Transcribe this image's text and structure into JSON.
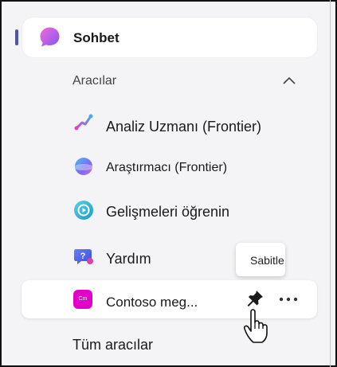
{
  "nav": {
    "chat_label": "Sohbet",
    "tools_header": "Aracılar",
    "all_tools_label": "Tüm aracılar"
  },
  "tools": [
    {
      "label": "Analiz Uzmanı (Frontier)",
      "icon": "analyst-icon"
    },
    {
      "label": "Araştırmacı (Frontier)",
      "icon": "researcher-icon"
    },
    {
      "label": "Gelişmeleri öğrenin",
      "icon": "catch-up-icon"
    },
    {
      "label": "Yardım",
      "icon": "help-icon"
    }
  ],
  "pinned_candidate": {
    "label": "Contoso meg...",
    "icon_text": "Cm",
    "tooltip": "Sabitle"
  },
  "colors": {
    "accent": "#4f52b2",
    "row_bg": "#ffffff",
    "sidebar_bg": "#f4f4f6",
    "contoso": "#e300c8"
  }
}
